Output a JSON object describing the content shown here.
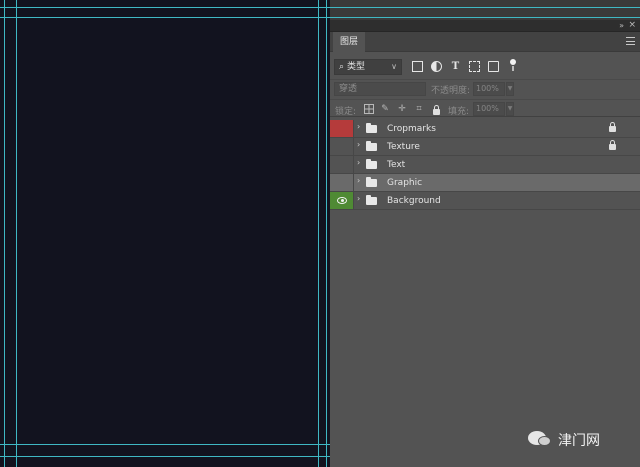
{
  "window": {
    "collapse_glyph": "»",
    "close_glyph": "×"
  },
  "panel": {
    "tab_label": "图层",
    "menu_icon": "hamburger-icon"
  },
  "filter": {
    "kind_label": "类型",
    "search_glyph": "⌕",
    "chevron_glyph": "∨",
    "icons": [
      "pixel-layer-filter-icon",
      "adjustment-layer-filter-icon",
      "type-layer-filter-icon",
      "shape-layer-filter-icon",
      "smart-object-filter-icon",
      "filter-toggle-icon"
    ],
    "type_glyph": "T"
  },
  "blend": {
    "mode": "穿透",
    "opacity_label": "不透明度:",
    "opacity_value": "100%"
  },
  "lock": {
    "label": "锁定:",
    "fill_label": "填充:",
    "fill_value": "100%",
    "icons": [
      "lock-transparent-pixels-icon",
      "lock-image-pixels-icon",
      "lock-position-icon",
      "lock-artboard-icon",
      "lock-all-icon"
    ],
    "brush_glyph": "✎",
    "move_glyph": "✛",
    "artboard_glyph": "⌗"
  },
  "layers": [
    {
      "name": "Cropmarks",
      "visibility": "hidden",
      "label_color": "#b53b3b",
      "locked": true,
      "selected": false
    },
    {
      "name": "Texture",
      "visibility": "hidden",
      "label_color": "",
      "locked": true,
      "selected": false
    },
    {
      "name": "Text",
      "visibility": "hidden",
      "label_color": "",
      "locked": false,
      "selected": false
    },
    {
      "name": "Graphic",
      "visibility": "hidden",
      "label_color": "",
      "locked": false,
      "selected": true
    },
    {
      "name": "Background",
      "visibility": "visible",
      "label_color": "#4f8a34",
      "locked": false,
      "selected": false
    }
  ],
  "layer_expander_glyph": "›",
  "watermark": {
    "text": "津门网"
  },
  "colors": {
    "panel_bg": "#535353",
    "canvas_bg": "#12131f",
    "guide": "#3fb8c4",
    "selected_row": "#6a6a6a"
  }
}
